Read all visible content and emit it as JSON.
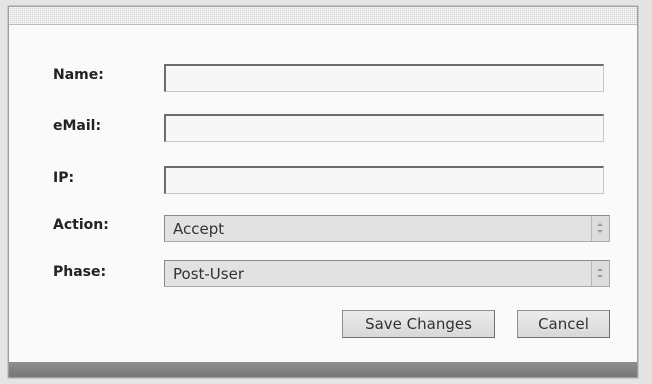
{
  "form": {
    "fields": [
      {
        "label": "Name:",
        "value": ""
      },
      {
        "label": "eMail:",
        "value": ""
      },
      {
        "label": "IP:",
        "value": ""
      }
    ],
    "action": {
      "label": "Action:",
      "value": "Accept"
    },
    "phase": {
      "label": "Phase:",
      "value": "Post-User"
    }
  },
  "buttons": {
    "save": "Save Changes",
    "cancel": "Cancel"
  }
}
